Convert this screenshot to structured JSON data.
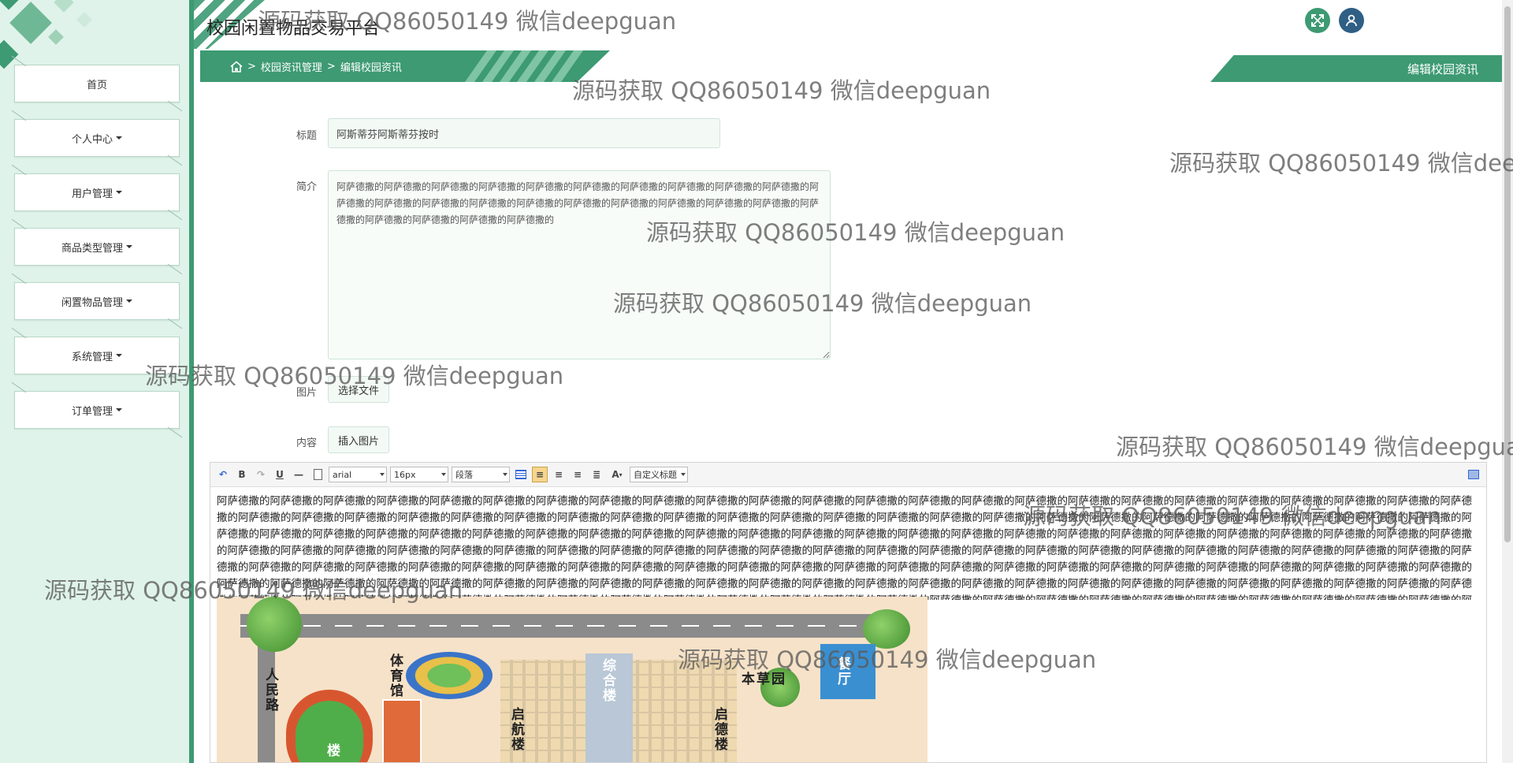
{
  "app": {
    "title": "校园闲置物品交易平台"
  },
  "sidebar": {
    "items": [
      {
        "label": "首页",
        "dropdown": false
      },
      {
        "label": "个人中心",
        "dropdown": true
      },
      {
        "label": "用户管理",
        "dropdown": true
      },
      {
        "label": "商品类型管理",
        "dropdown": true
      },
      {
        "label": "闲置物品管理",
        "dropdown": true
      },
      {
        "label": "系统管理",
        "dropdown": true
      },
      {
        "label": "订单管理",
        "dropdown": true
      }
    ]
  },
  "header": {
    "fullscreen_icon": "expand-icon",
    "user_icon": "user-icon"
  },
  "breadcrumb": {
    "sep": ">",
    "items": [
      "校园资讯管理",
      "编辑校园资讯"
    ]
  },
  "page_tag": "编辑校园资讯",
  "form": {
    "title_label": "标题",
    "title_value": "阿斯蒂芬阿斯蒂芬按时",
    "intro_label": "简介",
    "intro_value": "阿萨德撒的阿萨德撒的阿萨德撒的阿萨德撒的阿萨德撒的阿萨德撒的阿萨德撒的阿萨德撒的阿萨德撒的阿萨德撒的阿萨德撒的阿萨德撒的阿萨德撒的阿萨德撒的阿萨德撒的阿萨德撒的阿萨德撒的阿萨德撒的阿萨德撒的阿萨德撒的阿萨德撒的阿萨德撒的阿萨德撒的阿萨德撒的阿萨德撒的",
    "image_label": "图片",
    "choose_file": "选择文件",
    "content_label": "内容",
    "insert_image": "插入图片"
  },
  "editor": {
    "font_family": "arial",
    "font_size": "16px",
    "paragraph": "段落",
    "custom_title": "自定义标题",
    "content": "阿萨德撒的阿萨德撒的阿萨德撒的阿萨德撒的阿萨德撒的阿萨德撒的阿萨德撒的阿萨德撒的阿萨德撒的阿萨德撒的阿萨德撒的阿萨德撒的阿萨德撒的阿萨德撒的阿萨德撒的阿萨德撒的阿萨德撒的阿萨德撒的阿萨德撒的阿萨德撒的阿萨德撒的阿萨德撒的阿萨德撒的阿萨德撒的阿萨德撒的阿萨德撒的阿萨德撒的阿萨德撒的阿萨德撒的阿萨德撒的阿萨德撒的阿萨德撒的阿萨德撒的阿萨德撒的阿萨德撒的阿萨德撒的阿萨德撒的阿萨德撒的阿萨德撒的阿萨德撒的阿萨德撒的阿萨德撒的阿萨德撒的阿萨德撒的阿萨德撒的阿萨德撒的阿萨德撒的阿萨德撒的阿萨德撒的阿萨德撒的阿萨德撒的阿萨德撒的阿萨德撒的阿萨德撒的阿萨德撒的阿萨德撒的阿萨德撒的阿萨德撒的阿萨德撒的阿萨德撒的阿萨德撒的阿萨德撒的阿萨德撒的阿萨德撒的阿萨德撒的阿萨德撒的阿萨德撒的阿萨德撒的阿萨德撒的阿萨德撒的阿萨德撒的阿萨德撒的阿萨德撒的阿萨德撒的阿萨德撒的阿萨德撒的阿萨德撒的阿萨德撒的阿萨德撒的阿萨德撒的阿萨德撒的阿萨德撒的阿萨德撒的阿萨德撒的阿萨德撒的阿萨德撒的阿萨德撒的阿萨德撒的阿萨德撒的阿萨德撒的阿萨德撒的阿萨德撒的阿萨德撒的阿萨德撒的阿萨德撒的阿萨德撒的阿萨德撒的阿萨德撒的阿萨德撒的阿萨德撒的阿萨德撒的阿萨德撒的阿萨德撒的阿萨德撒的阿萨德撒的阿萨德撒的阿萨德撒的阿萨德撒的阿萨德撒的阿萨德撒的阿萨德撒的阿萨德撒的阿萨德撒的阿萨德撒的阿萨德撒的阿萨德撒的阿萨德撒的阿萨德撒的阿萨德撒的阿萨德撒的阿萨德撒的阿萨德撒的阿萨德撒的阿萨德撒的阿萨德撒的阿萨德撒的阿萨德撒的阿萨德撒的阿萨德撒的阿萨德撒的阿萨德撒的阿萨德撒的阿萨德撒的阿萨德撒的阿萨德撒的阿萨德撒的阿萨德撒的阿萨德撒的阿萨德撒的阿萨德撒的阿萨德撒的阿萨德撒的阿萨德撒的阿萨德撒的阿萨德撒的阿萨德撒的阿萨德撒的阿萨德撒的阿萨德撒的阿萨德撒的阿萨德撒的阿萨德撒的阿萨德撒的阿萨德撒的阿萨德撒的阿萨德撒的阿萨德撒的阿萨德撒的阿萨德撒的阿萨德撒的阿萨德撒的阿萨德撒的阿萨德撒的阿萨德撒的阿萨德撒的阿萨德撒的阿萨德撒的阿萨德撒的阿萨德撒的阿萨德撒的阿萨德撒的阿萨德撒的阿萨德撒的阿萨德撒的阿萨德撒的阿萨德撒的阿萨德撒的阿萨德撒的阿萨德撒的阿萨德撒的阿萨德撒的阿萨德撒的阿萨德撒的阿萨德撒的"
  },
  "campus_map": {
    "labels": [
      "人民路",
      "体育馆",
      "综合楼",
      "本草园",
      "餐厅",
      "启航楼",
      "启德楼",
      "楼"
    ]
  },
  "watermark": "源码获取 QQ86050149 微信deepguan",
  "colors": {
    "accent": "#3d9a73",
    "sidebar_bg": "#dff3ea"
  }
}
